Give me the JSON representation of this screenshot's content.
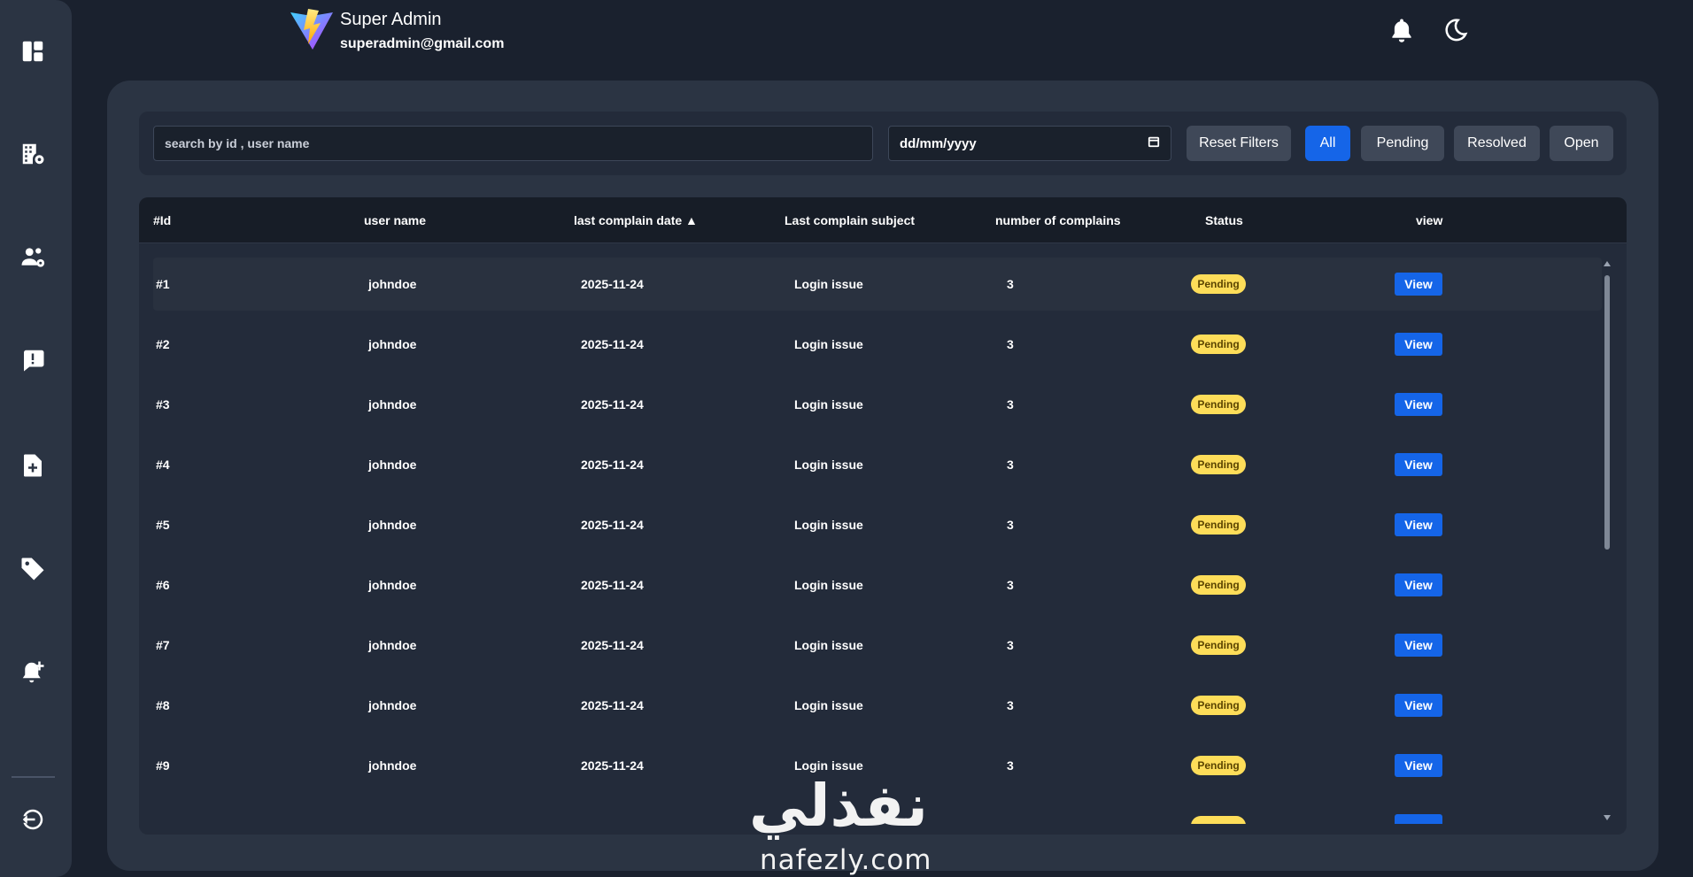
{
  "sidebar": {
    "items": [
      {
        "name": "dashboard-icon"
      },
      {
        "name": "building-settings-icon"
      },
      {
        "name": "users-settings-icon"
      },
      {
        "name": "complaint-message-icon"
      },
      {
        "name": "add-document-icon"
      },
      {
        "name": "tag-icon"
      },
      {
        "name": "add-notification-icon"
      }
    ],
    "logout_icon": "logout-icon"
  },
  "header": {
    "admin_name": "Super Admin",
    "admin_email": "superadmin@gmail.com",
    "icons": [
      "bell-icon",
      "moon-icon"
    ]
  },
  "filters": {
    "search_placeholder": "search by id , user name",
    "date_placeholder": "dd/mm/yyyy",
    "reset_label": "Reset Filters",
    "status_buttons": [
      {
        "label": "All",
        "active": true
      },
      {
        "label": "Pending",
        "active": false
      },
      {
        "label": "Resolved",
        "active": false
      },
      {
        "label": "Open",
        "active": false
      }
    ]
  },
  "table": {
    "headers": {
      "id": "#Id",
      "user_name": "user name",
      "last_date": "last complain date ▲",
      "last_subject": "Last complain subject",
      "count": "number of complains",
      "status": "Status",
      "view": "view"
    },
    "rows": [
      {
        "id": "#1",
        "user": "johndoe",
        "date": "2025-11-24",
        "subject": "Login issue",
        "count": "3",
        "status": "Pending",
        "action": "View"
      },
      {
        "id": "#2",
        "user": "johndoe",
        "date": "2025-11-24",
        "subject": "Login issue",
        "count": "3",
        "status": "Pending",
        "action": "View"
      },
      {
        "id": "#3",
        "user": "johndoe",
        "date": "2025-11-24",
        "subject": "Login issue",
        "count": "3",
        "status": "Pending",
        "action": "View"
      },
      {
        "id": "#4",
        "user": "johndoe",
        "date": "2025-11-24",
        "subject": "Login issue",
        "count": "3",
        "status": "Pending",
        "action": "View"
      },
      {
        "id": "#5",
        "user": "johndoe",
        "date": "2025-11-24",
        "subject": "Login issue",
        "count": "3",
        "status": "Pending",
        "action": "View"
      },
      {
        "id": "#6",
        "user": "johndoe",
        "date": "2025-11-24",
        "subject": "Login issue",
        "count": "3",
        "status": "Pending",
        "action": "View"
      },
      {
        "id": "#7",
        "user": "johndoe",
        "date": "2025-11-24",
        "subject": "Login issue",
        "count": "3",
        "status": "Pending",
        "action": "View"
      },
      {
        "id": "#8",
        "user": "johndoe",
        "date": "2025-11-24",
        "subject": "Login issue",
        "count": "3",
        "status": "Pending",
        "action": "View"
      },
      {
        "id": "#9",
        "user": "johndoe",
        "date": "2025-11-24",
        "subject": "Login issue",
        "count": "3",
        "status": "Pending",
        "action": "View"
      }
    ]
  },
  "watermark": {
    "arabic": "نفذلي",
    "latin": "nafezly.com"
  },
  "colors": {
    "background": "#1a212e",
    "panel": "#2b3443",
    "accent": "#1565e8",
    "pending_badge": "#fddd59"
  }
}
